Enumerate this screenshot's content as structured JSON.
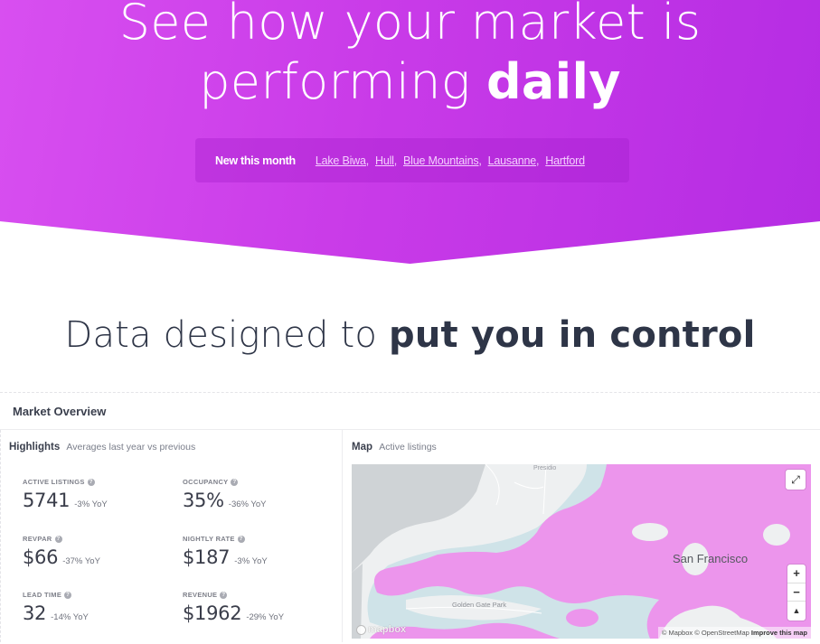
{
  "hero": {
    "line1": "See how your market is",
    "line2_regular": "performing ",
    "line2_bold": "daily",
    "new_label": "New this month",
    "cities": [
      "Lake Biwa,",
      "Hull,",
      "Blue Mountains,",
      "Lausanne,",
      "Hartford"
    ]
  },
  "section": {
    "title_regular": "Data designed to ",
    "title_bold": "put you in control"
  },
  "panel": {
    "title": "Market Overview",
    "highlights": {
      "title": "Highlights",
      "subtitle": "Averages last year vs previous",
      "help_glyph": "?",
      "stats": [
        {
          "label": "ACTIVE LISTINGS",
          "value": "5741",
          "delta": "-3% YoY"
        },
        {
          "label": "OCCUPANCY",
          "value": "35%",
          "delta": "-36% YoY"
        },
        {
          "label": "REVPAR",
          "value": "$66",
          "delta": "-37% YoY"
        },
        {
          "label": "NIGHTLY RATE",
          "value": "$187",
          "delta": "-3% YoY"
        },
        {
          "label": "LEAD TIME",
          "value": "32",
          "delta": "-14% YoY"
        },
        {
          "label": "REVENUE",
          "value": "$1962",
          "delta": "-29% YoY"
        }
      ]
    },
    "map": {
      "title": "Map",
      "subtitle": "Active listings",
      "labels": {
        "presidio": "Presidio",
        "city": "San Francisco",
        "park": "Golden Gate Park"
      },
      "controls": {
        "fullscreen_glyph": "⤢",
        "zoom_in": "+",
        "zoom_out": "−",
        "compass": "▲"
      },
      "logo": "mapbox",
      "attribution": "© Mapbox © OpenStreetMap",
      "improve_link": "Improve this map",
      "colors": {
        "heat": "#ec95ec",
        "water": "#cfd3d6",
        "land": "#eef0f1",
        "halo": "#cfe3e8"
      }
    }
  }
}
